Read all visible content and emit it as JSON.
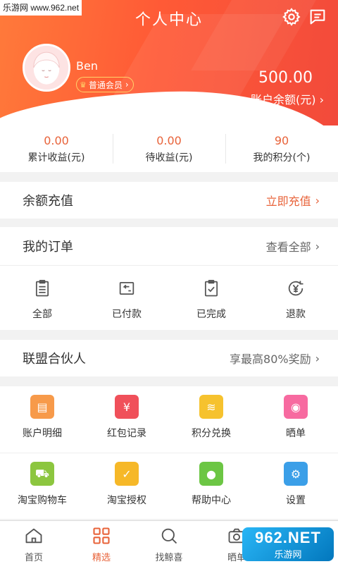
{
  "watermark": "乐游网 www.962.net",
  "header": {
    "title": "个人中心",
    "username": "Ben",
    "member_label": "普通会员",
    "balance": "500.00",
    "balance_label": "账户余额(元)"
  },
  "stats": [
    {
      "value": "0.00",
      "label": "累计收益(元)"
    },
    {
      "value": "0.00",
      "label": "待收益(元)"
    },
    {
      "value": "90",
      "label": "我的积分(个)"
    }
  ],
  "recharge": {
    "title": "余额充值",
    "action": "立即充值"
  },
  "orders": {
    "title": "我的订单",
    "view_all": "查看全部",
    "items": [
      {
        "label": "全部",
        "icon": "clipboard-list-icon"
      },
      {
        "label": "已付款",
        "icon": "paid-icon"
      },
      {
        "label": "已完成",
        "icon": "clipboard-check-icon"
      },
      {
        "label": "退款",
        "icon": "refund-icon"
      }
    ]
  },
  "partner": {
    "title": "联盟合伙人",
    "action": "享最高80%奖励"
  },
  "grid": [
    {
      "label": "账户明细",
      "icon": "account-detail-icon",
      "color": "#f79a4a"
    },
    {
      "label": "红包记录",
      "icon": "red-packet-icon",
      "color": "#f0505a"
    },
    {
      "label": "积分兑换",
      "icon": "coins-icon",
      "color": "#f6c22e"
    },
    {
      "label": "晒单",
      "icon": "camera-icon",
      "color": "#f76aa0"
    },
    {
      "label": "淘宝购物车",
      "icon": "cart-icon",
      "color": "#8cc63f"
    },
    {
      "label": "淘宝授权",
      "icon": "shield-check-icon",
      "color": "#f6b828"
    },
    {
      "label": "帮助中心",
      "icon": "bulb-icon",
      "color": "#6cc644"
    },
    {
      "label": "设置",
      "icon": "gear-icon",
      "color": "#3b9fe8"
    }
  ],
  "tabs": [
    {
      "label": "首页",
      "icon": "home-icon"
    },
    {
      "label": "精选",
      "icon": "grid-icon",
      "active": true
    },
    {
      "label": "找鲸喜",
      "icon": "search-icon"
    },
    {
      "label": "晒单",
      "icon": "camera-icon"
    }
  ],
  "brand": {
    "line1": "962.NET",
    "line2": "乐游网"
  },
  "colors": {
    "accent": "#e8633a",
    "header_start": "#ff7a3a",
    "header_end": "#f24a3b"
  }
}
